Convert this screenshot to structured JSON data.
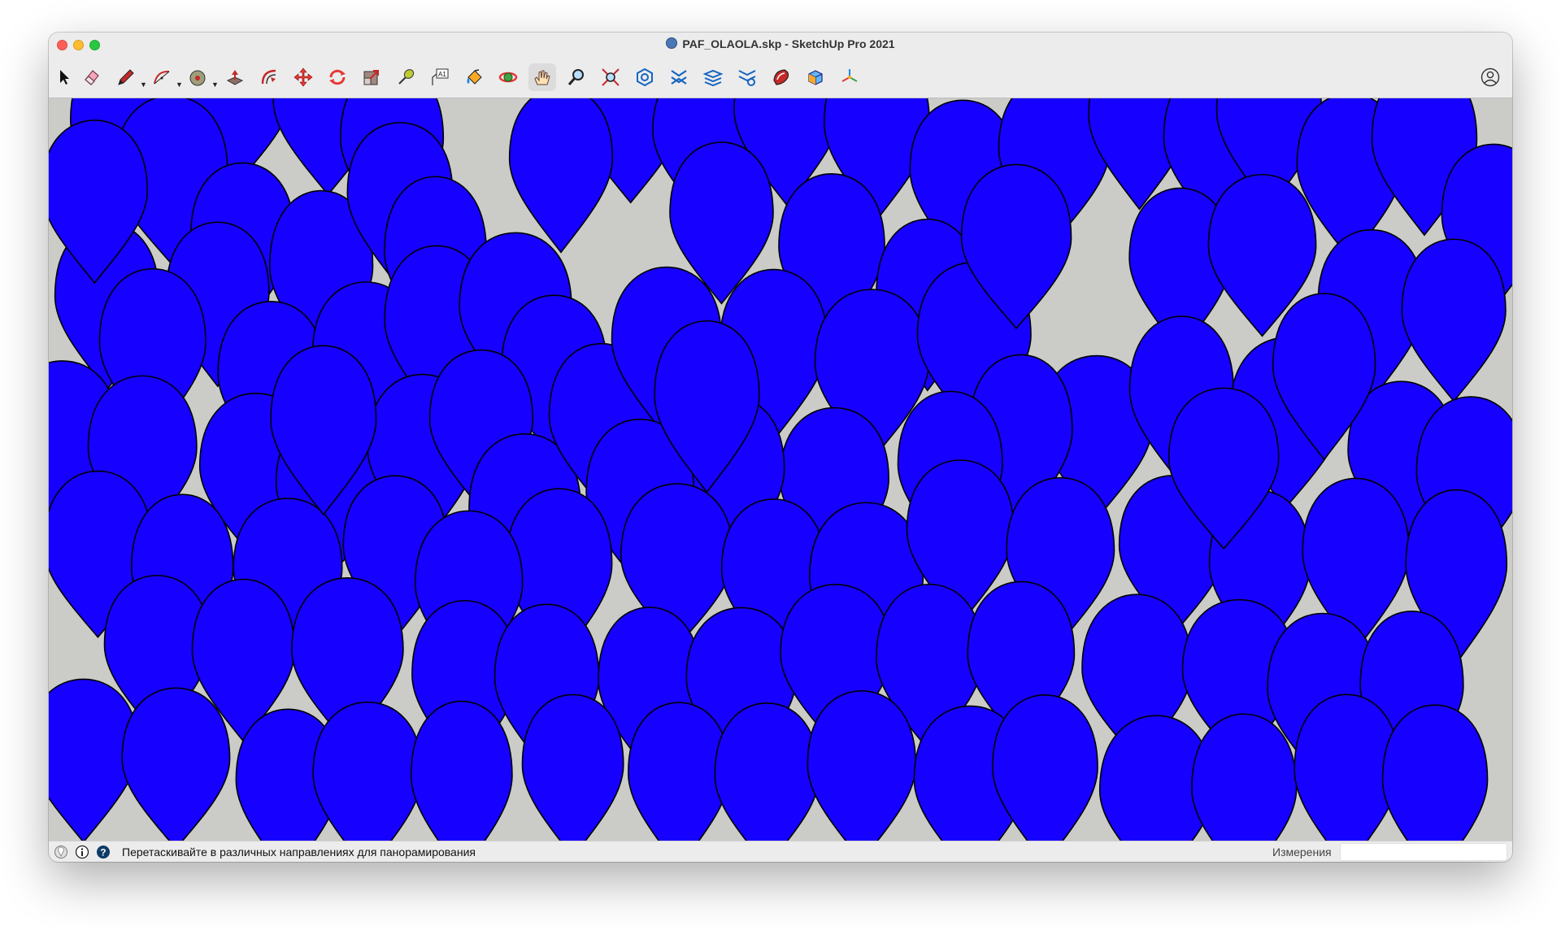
{
  "window": {
    "title": "PAF_OLAOLA.skp - SketchUp Pro 2021",
    "document_icon": "sketchup-document-icon"
  },
  "toolbar": {
    "tools": [
      {
        "name": "select",
        "icon": "arrow-cursor-icon"
      },
      {
        "name": "eraser",
        "icon": "eraser-icon"
      },
      {
        "name": "line",
        "icon": "pencil-icon",
        "has_dropdown": true
      },
      {
        "name": "arc",
        "icon": "arc-icon",
        "has_dropdown": true
      },
      {
        "name": "shapes",
        "icon": "shapes-icon",
        "has_dropdown": true
      },
      {
        "name": "push-pull",
        "icon": "push-pull-icon"
      },
      {
        "name": "offset",
        "icon": "offset-icon"
      },
      {
        "name": "move",
        "icon": "move-icon"
      },
      {
        "name": "rotate",
        "icon": "rotate-icon"
      },
      {
        "name": "scale",
        "icon": "scale-icon"
      },
      {
        "name": "tape-measure",
        "icon": "tape-measure-icon"
      },
      {
        "name": "text",
        "icon": "text-label-icon"
      },
      {
        "name": "paint-bucket",
        "icon": "paint-bucket-icon"
      },
      {
        "name": "orbit",
        "icon": "orbit-icon"
      },
      {
        "name": "pan",
        "icon": "hand-pan-icon",
        "active": true
      },
      {
        "name": "zoom",
        "icon": "magnifier-icon"
      },
      {
        "name": "zoom-extents",
        "icon": "zoom-extents-icon"
      },
      {
        "name": "3d-warehouse",
        "icon": "warehouse-icon"
      },
      {
        "name": "extension-warehouse",
        "icon": "extension-warehouse-icon"
      },
      {
        "name": "layout",
        "icon": "layout-stack-icon"
      },
      {
        "name": "extension-manager",
        "icon": "extension-manager-icon"
      },
      {
        "name": "ruby-console",
        "icon": "ruby-icon"
      },
      {
        "name": "components",
        "icon": "cube-icon"
      },
      {
        "name": "axes",
        "icon": "axes-icon"
      }
    ],
    "account_icon": "account-icon"
  },
  "viewport": {
    "background_color": "#cbcbc8",
    "balloon_color": "#1600ff",
    "outline_color": "#000000"
  },
  "statusbar": {
    "message": "Перетаскивайте в различных направлениях для панорамирования",
    "measurements_label": "Измерения",
    "measurements_value": "",
    "icons": [
      "geo-location-icon",
      "info-icon",
      "help-icon"
    ]
  }
}
